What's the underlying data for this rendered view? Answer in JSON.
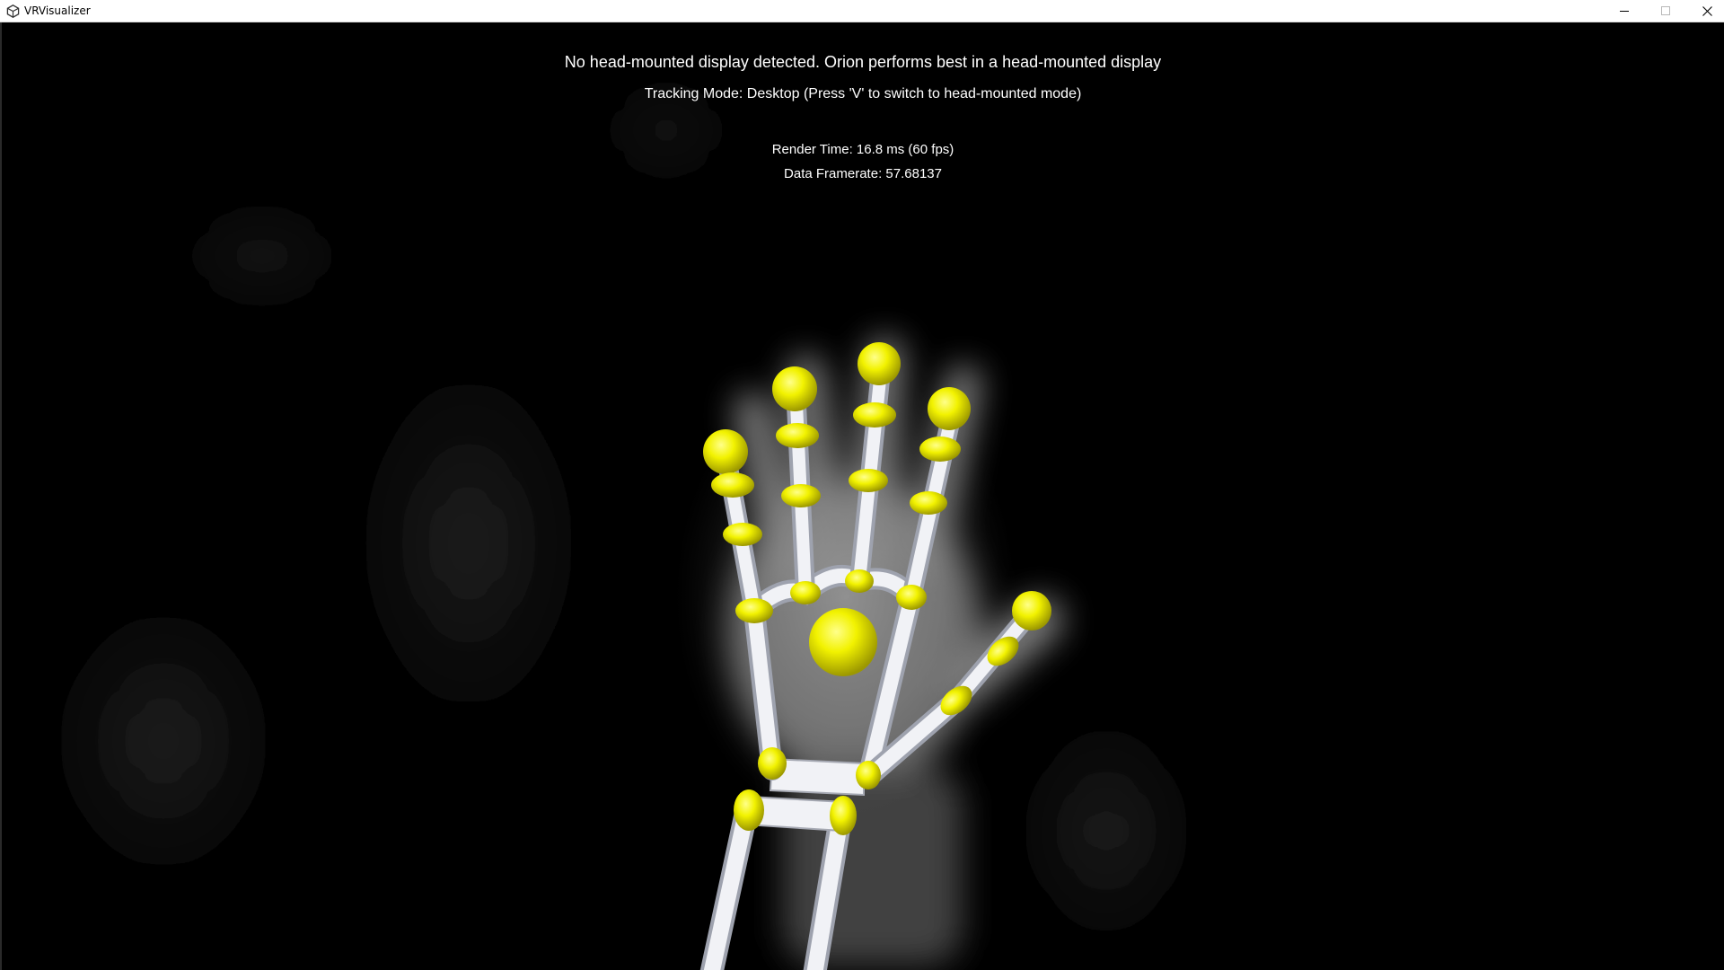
{
  "window": {
    "title": "VRVisualizer",
    "app_icon": "unity-logo-icon",
    "controls": {
      "minimize_icon": "minimize-icon",
      "maximize_icon": "maximize-icon",
      "close_icon": "close-icon"
    }
  },
  "overlay": {
    "hmd_warning": "No head-mounted display detected. Orion performs best in a head-mounted display",
    "tracking_mode": "Tracking Mode: Desktop (Press 'V' to switch to head-mounted mode)",
    "render_time": "Render Time: 16.8 ms (60 fps)",
    "data_framerate": "Data Framerate: 57.68137"
  },
  "scene": {
    "background_color": "#000000",
    "bone_color": "#e4e6ec",
    "joint_color": "#f2f200",
    "palm_color": "#f2f200"
  }
}
